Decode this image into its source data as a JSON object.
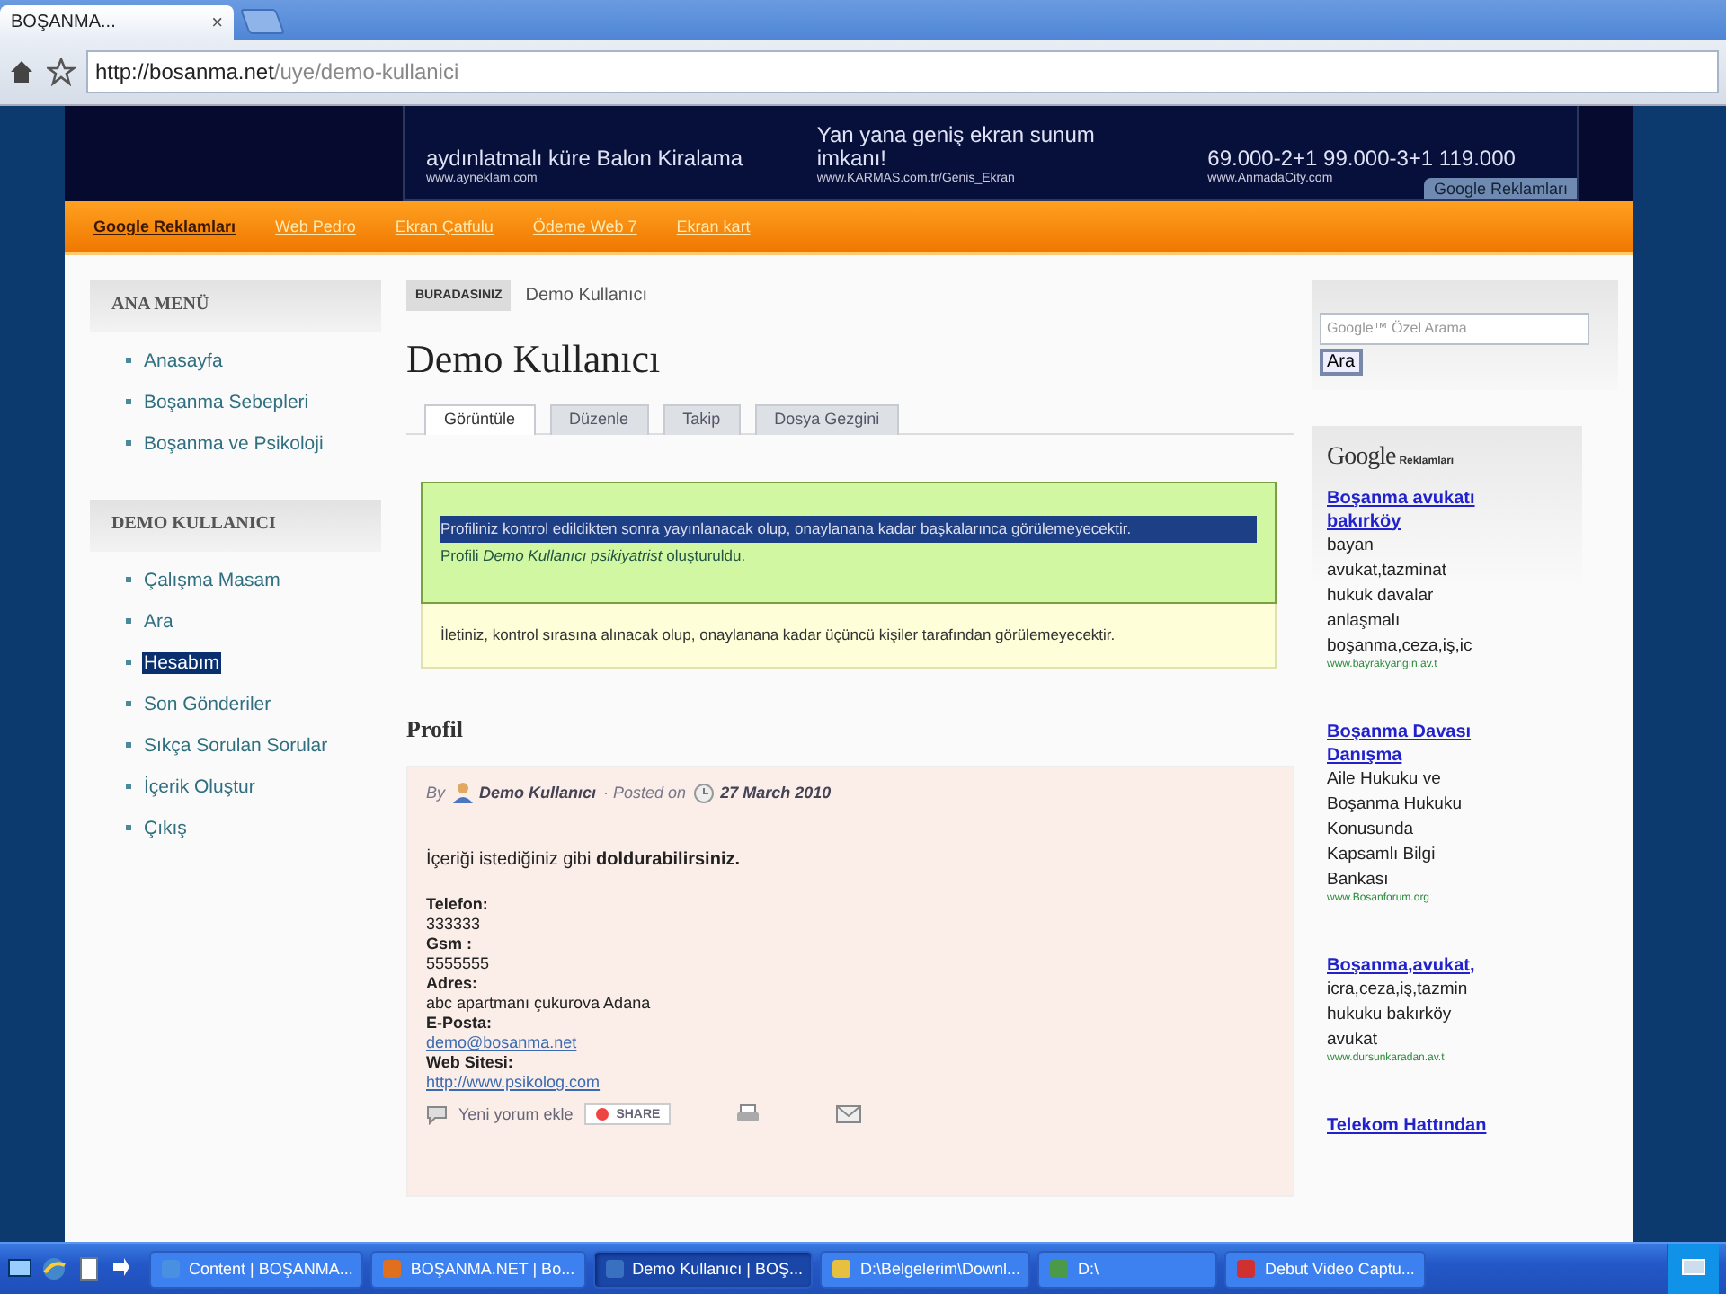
{
  "browser": {
    "tab_title": "BOŞANMA...",
    "tab_close": "×",
    "url_host": "http://bosanma.net",
    "url_path": "/uye/demo-kullanici"
  },
  "ad_banner": {
    "ads": [
      {
        "lines": [
          "aydınlatmalı küre Balon Kiralama"
        ],
        "url": "www.ayneklam.com"
      },
      {
        "lines": [
          "Yan yana geniş ekran sunum",
          "imkanı!"
        ],
        "url": "www.KARMAS.com.tr/Genis_Ekran"
      },
      {
        "lines": [
          "69.000-2+1 99.000-3+1 119.000"
        ],
        "url": "www.AnmadaCity.com"
      }
    ],
    "badge": "Google Reklamları"
  },
  "nav": {
    "items": [
      {
        "label": "Google Reklamları",
        "kind": "heading"
      },
      {
        "label": "Web Pedro",
        "kind": "link"
      },
      {
        "label": "Ekran Çatfulu",
        "kind": "link"
      },
      {
        "label": "Ödeme Web 7",
        "kind": "link"
      },
      {
        "label": "Ekran kart",
        "kind": "link"
      }
    ]
  },
  "sidebar": {
    "blocks": [
      {
        "title": "ANA MENÜ",
        "items": [
          {
            "label": "Anasayfa",
            "selected": false
          },
          {
            "label": "Boşanma Sebepleri",
            "selected": false
          },
          {
            "label": "Boşanma ve Psikoloji",
            "selected": false
          }
        ]
      },
      {
        "title": "DEMO KULLANICI",
        "items": [
          {
            "label": "Çalışma Masam",
            "selected": false
          },
          {
            "label": "Ara",
            "selected": false
          },
          {
            "label": "Hesabım",
            "selected": true
          },
          {
            "label": "Son Gönderiler",
            "selected": false
          },
          {
            "label": "Sıkça Sorulan Sorular",
            "selected": false
          },
          {
            "label": "İçerik Oluştur",
            "selected": false
          },
          {
            "label": "Çıkış",
            "selected": false
          }
        ]
      }
    ]
  },
  "main": {
    "breadcrumb": {
      "label": "BURADASINIZ",
      "current": "Demo Kullanıcı"
    },
    "title": "Demo Kullanıcı",
    "tabs": [
      {
        "label": "Görüntüle",
        "selected": true
      },
      {
        "label": "Düzenle",
        "selected": false
      },
      {
        "label": "Takip",
        "selected": false
      },
      {
        "label": "Dosya Gezgini",
        "selected": false
      }
    ],
    "messages": [
      {
        "kind": "status",
        "texts": [
          {
            "text": "Profiliniz kontrol edildikten sonra yayınlanacak olup, onaylanana kadar başkalarınca görülemeyecektir.",
            "highlighted": true
          },
          {
            "text": "Profili *Demo Kullanıcı psikiyatrist* oluşturuldu.",
            "highlighted": false
          }
        ]
      },
      {
        "kind": "warning",
        "texts": [
          {
            "text": "İletiniz, kontrol sırasına alınacak olup, onaylanana kadar üçüncü kişiler tarafından görülemeyecektir.",
            "highlighted": false
          }
        ]
      }
    ],
    "section_title": "Profil",
    "post": {
      "by": "By",
      "author": "Demo Kullanıcı",
      "posted_on": "· Posted on",
      "date": "27 March 2010",
      "intro": "İçeriği istediğiniz gibi **doldurabilirsiniz.**",
      "fields": [
        {
          "label": "Telefon:",
          "value": "333333",
          "kind": "text"
        },
        {
          "label": "Gsm :",
          "value": "5555555",
          "kind": "text"
        },
        {
          "label": "Adres:",
          "value": "abc apartmanı çukurova Adana",
          "kind": "text"
        },
        {
          "label": "E-Posta:",
          "value": "demo@bosanma.net",
          "kind": "link"
        },
        {
          "label": "Web Sitesi:",
          "value": "http://www.psikolog.com",
          "kind": "link"
        }
      ],
      "comment_link": "Yeni yorum ekle",
      "share": "SHARE"
    }
  },
  "right": {
    "search": {
      "placeholder": "Google™ Özel Arama",
      "button": "Ara"
    },
    "ads_logo": "Google",
    "ads_label": "Reklamları",
    "ads": [
      {
        "title": "Boşanma avukatı bakırköy",
        "lines": [
          "bayan",
          "avukat,tazminat",
          "hukuk davalar",
          "anlaşmalı",
          "boşanma,ceza,iş,ic"
        ],
        "url": "www.bayrakyangın.av.t"
      },
      {
        "title": "Boşanma Davası Danışma",
        "lines": [
          "Aile Hukuku ve",
          "Boşanma Hukuku",
          "Konusunda",
          "Kapsamlı Bilgi",
          "Bankası"
        ],
        "url": "www.Bosanforum.org"
      },
      {
        "title": "Boşanma,avukat,",
        "lines": [
          "icra,ceza,iş,tazmin",
          "hukuku bakırköy",
          "avukat"
        ],
        "url": "www.dursunkaradan.av.t"
      },
      {
        "title": "Telekom Hattından"
      }
    ]
  },
  "taskbar": {
    "items": [
      {
        "label": "Content | BOŞANMA...",
        "selected": false
      },
      {
        "label": "BOŞANMA.NET | Bo...",
        "selected": false
      },
      {
        "label": "Demo Kullanıcı | BOŞ...",
        "selected": true
      },
      {
        "label": "D:\\Belgelerim\\Downl...",
        "selected": false
      },
      {
        "label": "D:\\",
        "selected": false
      },
      {
        "label": "Debut Video Captu...",
        "selected": false
      }
    ]
  }
}
